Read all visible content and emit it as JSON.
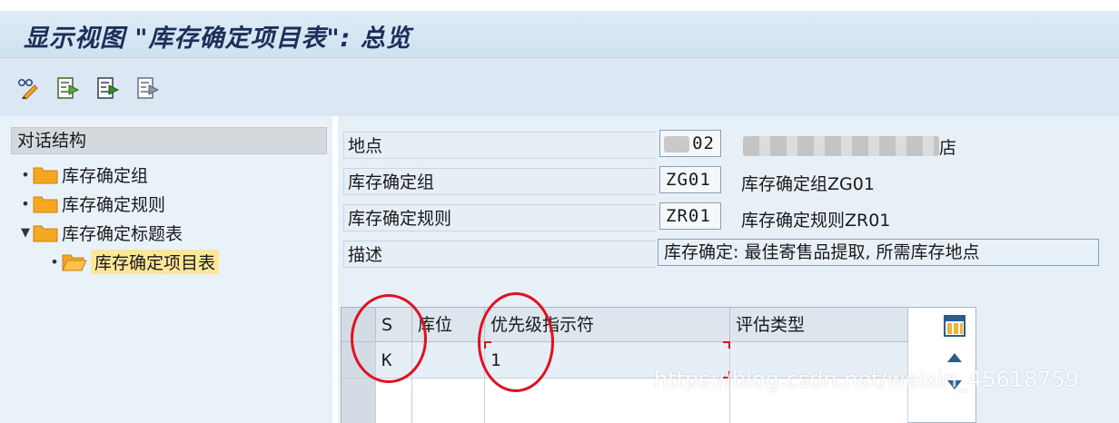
{
  "window": {
    "title": "显示视图 \"库存确定项目表\": 总览"
  },
  "toolbar": {
    "icons": [
      "glasses-pencil-icon",
      "export-icon",
      "export-dark-icon",
      "export-light-icon"
    ]
  },
  "tree": {
    "header": "对话结构",
    "items": [
      {
        "label": "库存确定组",
        "expanded": false
      },
      {
        "label": "库存确定规则",
        "expanded": false
      },
      {
        "label": "库存确定标题表",
        "expanded": true
      },
      {
        "label": "库存确定项目表",
        "selected": true
      }
    ]
  },
  "form": {
    "location_label": "地点",
    "location_value": "02",
    "location_suffix": "店",
    "group_label": "库存确定组",
    "group_value": "ZG01",
    "group_text": "库存确定组ZG01",
    "rule_label": "库存确定规则",
    "rule_value": "ZR01",
    "rule_text": "库存确定规则ZR01",
    "desc_label": "描述",
    "desc_value": "库存确定: 最佳寄售品提取, 所需库存地点"
  },
  "table": {
    "columns": [
      "S",
      "库位",
      "优先级指示符",
      "评估类型"
    ],
    "rows": [
      {
        "s": "K",
        "location": "",
        "priority": "1",
        "valuation": ""
      }
    ]
  },
  "watermark": "https://blog.csdn.net/weixin_45618759",
  "colors": {
    "highlight": "#e0121f",
    "selected": "#ffe79a",
    "folder": "#f5a623"
  }
}
